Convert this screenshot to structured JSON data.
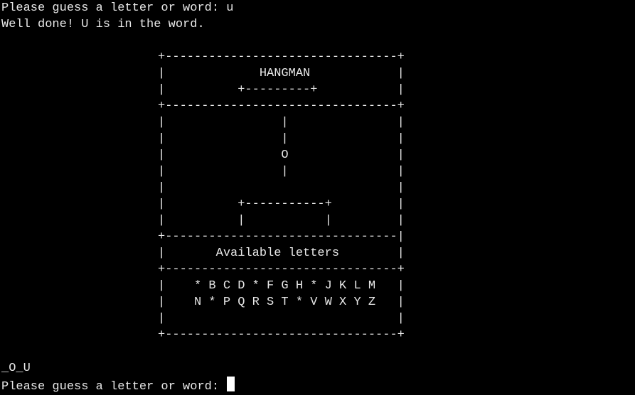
{
  "terminal": {
    "previous_prompt": "Please guess a letter or word: u",
    "feedback": "Well done! U is in the word.",
    "word_progress": "_O_U",
    "current_prompt": "Please guess a letter or word: "
  },
  "board": {
    "lines": [
      "+--------------------------------+",
      "|             HANGMAN            |",
      "|          +---------+           |",
      "+--------------------------------+",
      "|                |               |",
      "|                |               |",
      "|                O               |",
      "|                |               |",
      "|                                |",
      "|          +-----------+         |",
      "|          |           |         |",
      "+--------------------------------|",
      "|       Available letters        |",
      "+--------------------------------+",
      "|    * B C D * F G H * J K L M   |",
      "|    N * P Q R S T * V W X Y Z   |",
      "|                                |",
      "+--------------------------------+"
    ]
  },
  "colors": {
    "background": "#000000",
    "text": "#e8e8e8",
    "cursor": "#ffffff"
  }
}
